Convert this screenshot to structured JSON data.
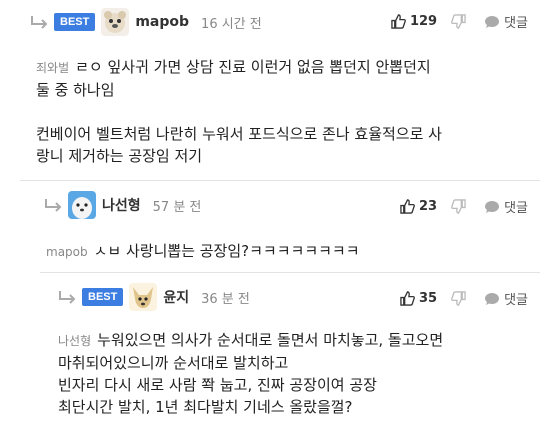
{
  "comments": [
    {
      "badge": "BEST",
      "author": "mapob",
      "time": "16 시간 전",
      "likes": "129",
      "reply_label": "댓글",
      "mention": "죄와벌",
      "lines": [
        "ㄹㅇ 잎사귀 가면 상담 진료 이런거 없음 뽑던지 안뽑던지",
        "둘 중 하나임",
        "",
        "컨베이어 벨트처럼 나란히 누워서 포드식으로 존나 효율적으로 사",
        "랑니 제거하는 공장임 저기"
      ]
    },
    {
      "author": "나선형",
      "time": "57 분 전",
      "likes": "23",
      "reply_label": "댓글",
      "mention": "mapob",
      "lines": [
        "ㅅㅂ 사랑니뽑는 공장임?ㅋㅋㅋㅋㅋㅋㅋㅋ"
      ]
    },
    {
      "badge": "BEST",
      "author": "윤지",
      "time": "36 분 전",
      "likes": "35",
      "reply_label": "댓글",
      "mention": "나선형",
      "lines": [
        "누워있으면 의사가 순서대로 돌면서 마치놓고, 돌고오면",
        "마취되어있으니까 순서대로 발치하고",
        "빈자리 다시 새로 사람 쫙 눕고, 진짜 공장이여 공장",
        "최단시간 발치, 1년 최다발치 기네스 올랐을껄?"
      ]
    }
  ],
  "colors": {
    "badge": "#3b7de0",
    "muted": "#888888",
    "divider": "#e3e3e3"
  }
}
